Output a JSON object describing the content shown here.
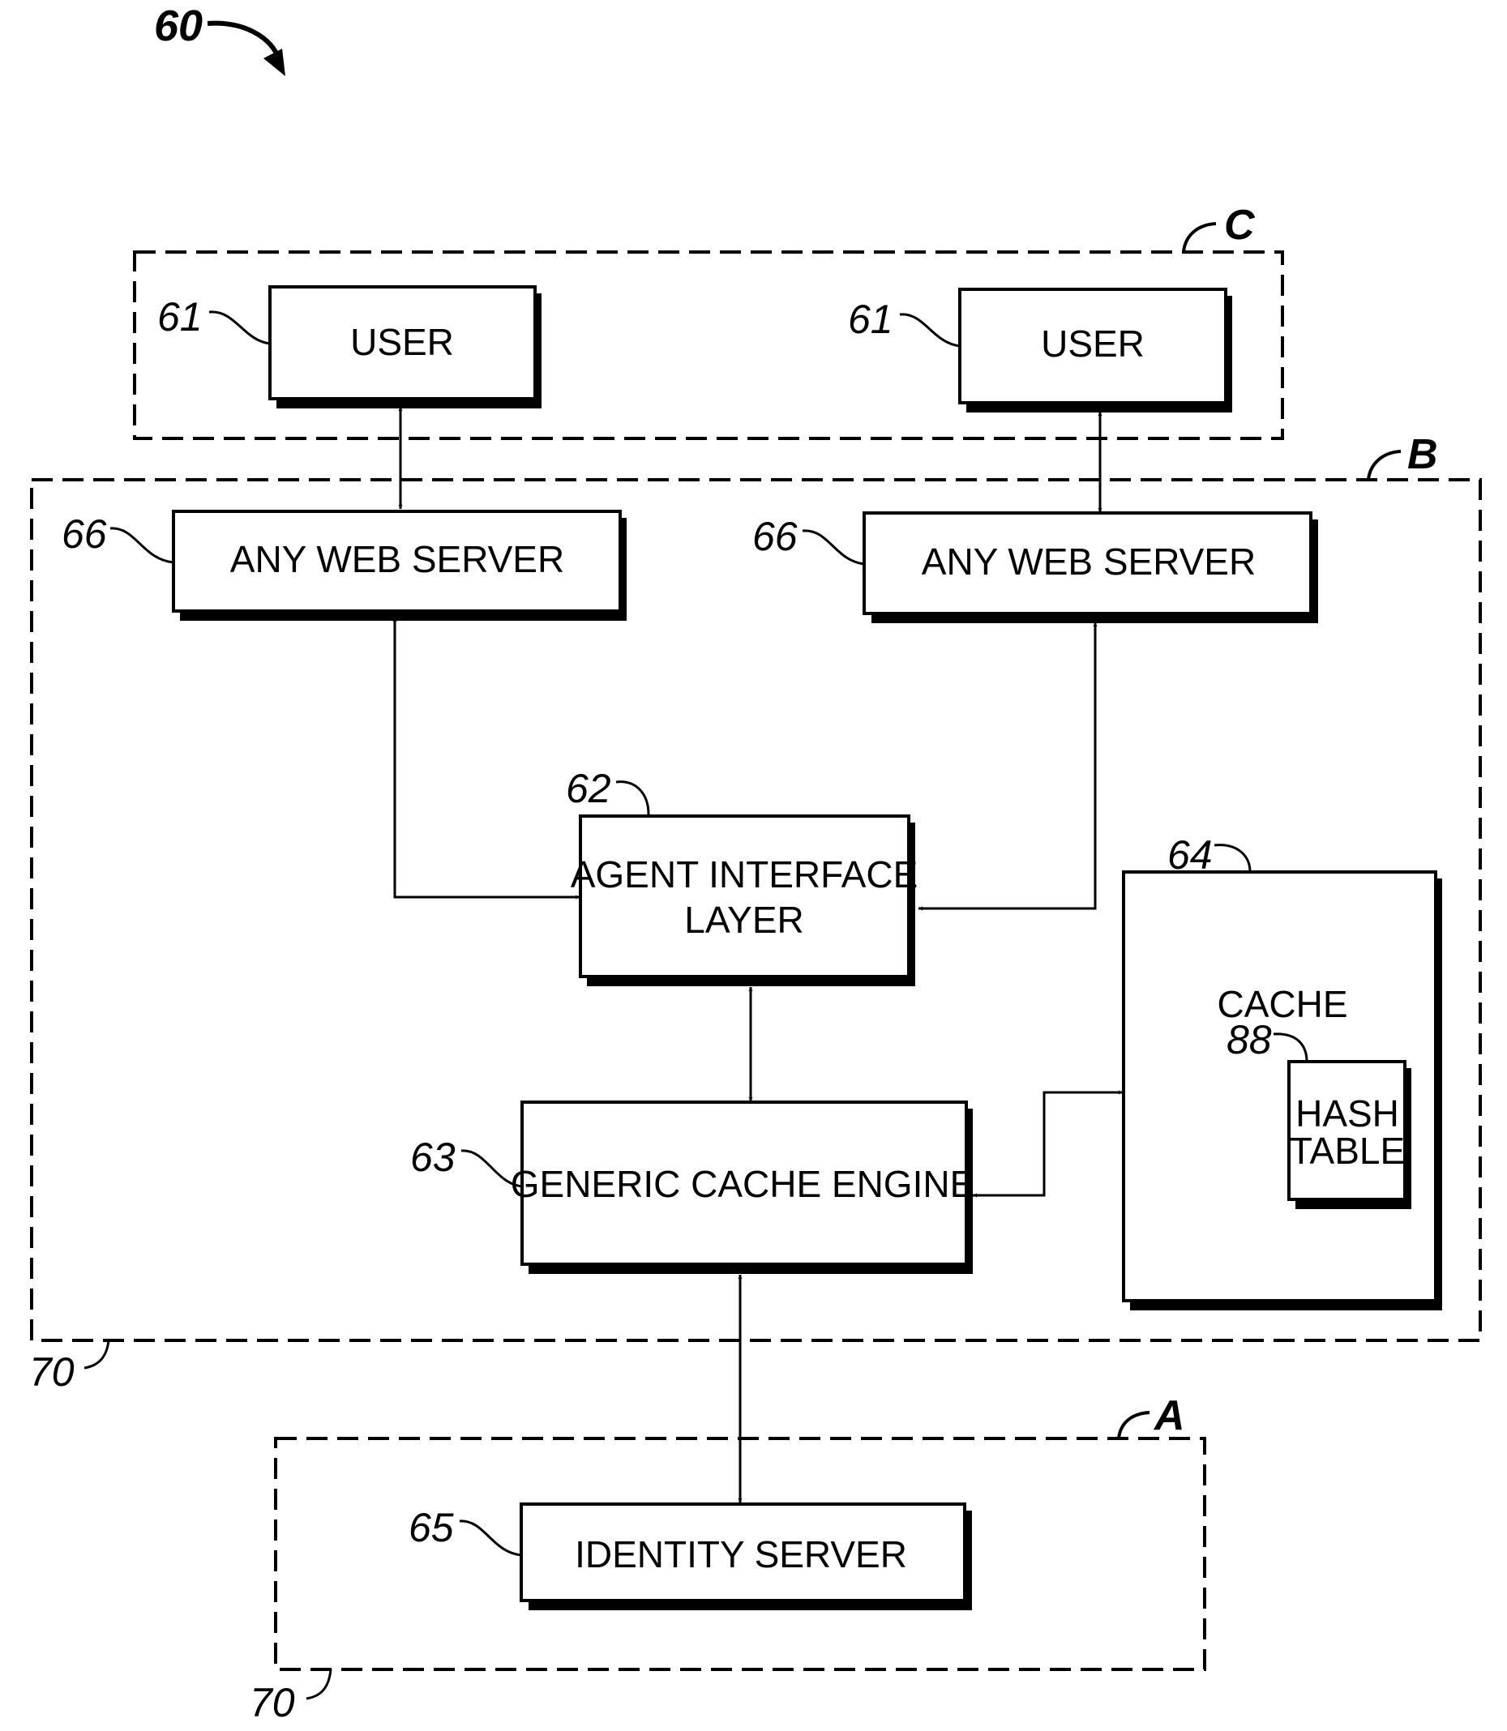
{
  "figure": {
    "ref": "60"
  },
  "zones": {
    "C": {
      "label": "C"
    },
    "B": {
      "label": "B",
      "ref": "70"
    },
    "A": {
      "label": "A",
      "ref": "70"
    }
  },
  "blocks": {
    "user_left": {
      "label": "USER",
      "ref": "61"
    },
    "user_right": {
      "label": "USER",
      "ref": "61"
    },
    "web_server_left": {
      "label": "ANY WEB SERVER",
      "ref": "66"
    },
    "web_server_right": {
      "label": "ANY WEB SERVER",
      "ref": "66"
    },
    "agent_interface": {
      "label_line1": "AGENT INTERFACE",
      "label_line2": "LAYER",
      "ref": "62"
    },
    "cache_engine": {
      "label": "GENERIC CACHE ENGINE",
      "ref": "63"
    },
    "cache": {
      "label": "CACHE",
      "ref": "64"
    },
    "hash_table": {
      "label_line1": "HASH",
      "label_line2": "TABLE",
      "ref": "88"
    },
    "identity_server": {
      "label": "IDENTITY SERVER",
      "ref": "65"
    }
  },
  "connections": [
    {
      "from": "user_left",
      "to": "web_server_left",
      "type": "bidirectional"
    },
    {
      "from": "user_right",
      "to": "web_server_right",
      "type": "bidirectional"
    },
    {
      "from": "web_server_left",
      "to": "agent_interface",
      "type": "bidirectional"
    },
    {
      "from": "web_server_right",
      "to": "agent_interface",
      "type": "bidirectional"
    },
    {
      "from": "agent_interface",
      "to": "cache_engine",
      "type": "bidirectional"
    },
    {
      "from": "cache_engine",
      "to": "cache",
      "type": "bidirectional"
    },
    {
      "from": "cache_engine",
      "to": "identity_server",
      "type": "bidirectional"
    }
  ]
}
